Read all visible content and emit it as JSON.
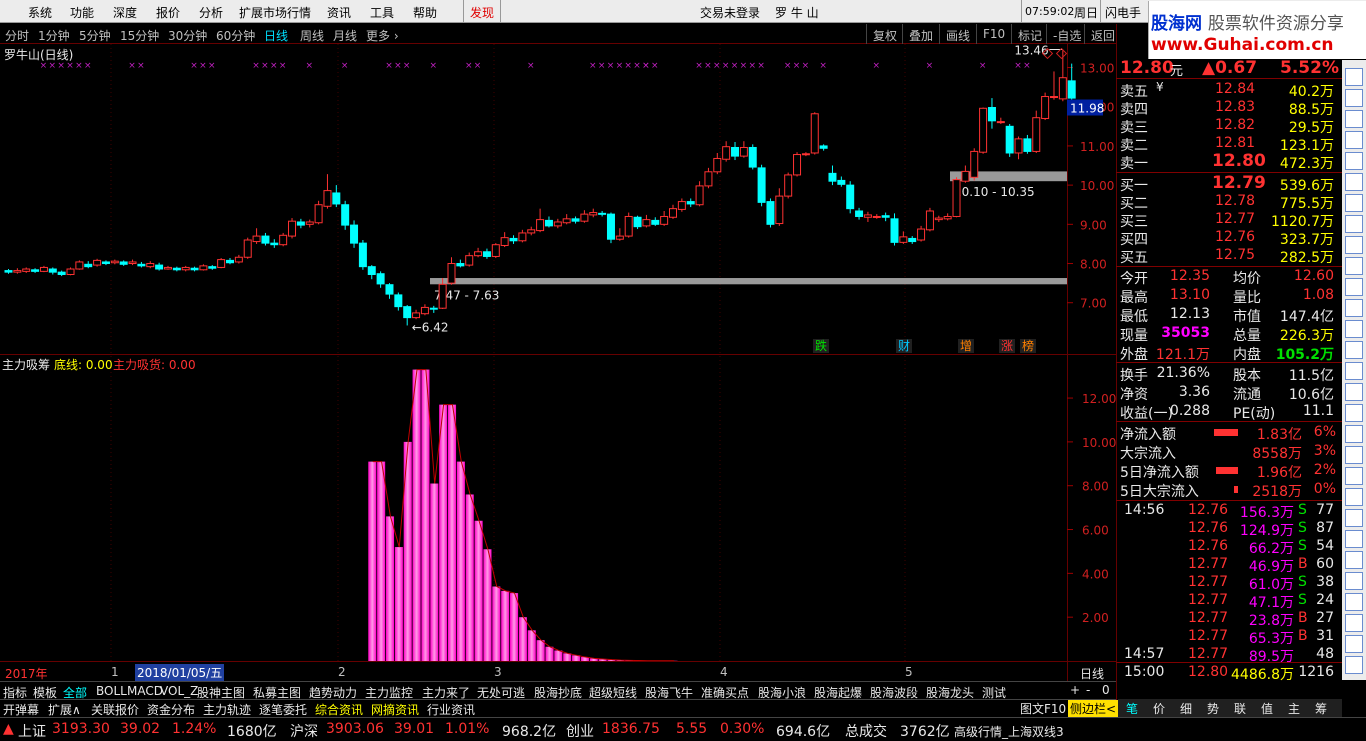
{
  "menubar": {
    "items": [
      "系统",
      "功能",
      "深度",
      "报价",
      "分析",
      "扩展市场行情",
      "资讯",
      "工具",
      "帮助"
    ],
    "discover": "发现",
    "login": "交易未登录",
    "stock": "罗 牛 山",
    "time": "07:59:02",
    "weekday": "周日",
    "flash": "闪电手"
  },
  "brand": {
    "name": "股海网",
    "slogan": "股票软件资源分享",
    "url": "www.Guhai.com.cn"
  },
  "periods": {
    "items": [
      "分时",
      "1分钟",
      "5分钟",
      "15分钟",
      "30分钟",
      "60分钟",
      "日线",
      "周线",
      "月线",
      "更多 ›"
    ],
    "selected": "日线"
  },
  "toolbar": {
    "buttons": [
      "复权",
      "叠加",
      "画线",
      "F10",
      "标记",
      "-自选",
      "返回"
    ]
  },
  "chart_title": "罗牛山(日线)",
  "chart_data": [
    {
      "type": "candlestick",
      "title": "罗牛山(日线)",
      "yticks": [
        "13.00",
        "12.00",
        "11.00",
        "10.00",
        "9.00",
        "8.00",
        "7.00"
      ],
      "ylim": [
        6.4,
        13.6
      ],
      "current_price_label": "11.98",
      "high_label": "13.46",
      "low_label": "6.42",
      "range_labels": [
        "7.47 - 7.63",
        "10.10 - 10.35"
      ],
      "event_marks": [
        "跌",
        "财",
        "增",
        "涨",
        "榜"
      ],
      "candles": [
        [
          7.82,
          7.78,
          7.86,
          7.74
        ],
        [
          7.78,
          7.82,
          7.88,
          7.74
        ],
        [
          7.8,
          7.86,
          7.9,
          7.76
        ],
        [
          7.84,
          7.8,
          7.88,
          7.76
        ],
        [
          7.8,
          7.9,
          7.94,
          7.78
        ],
        [
          7.86,
          7.78,
          7.9,
          7.72
        ],
        [
          7.78,
          7.72,
          7.82,
          7.68
        ],
        [
          7.72,
          7.86,
          7.9,
          7.7
        ],
        [
          7.86,
          8.04,
          8.08,
          7.84
        ],
        [
          7.98,
          7.92,
          8.06,
          7.88
        ],
        [
          7.96,
          8.08,
          8.12,
          7.92
        ],
        [
          8.04,
          8.0,
          8.08,
          7.96
        ],
        [
          8.02,
          8.06,
          8.1,
          7.98
        ],
        [
          8.04,
          7.98,
          8.08,
          7.94
        ],
        [
          8.0,
          8.04,
          8.1,
          7.96
        ],
        [
          7.98,
          7.94,
          8.04,
          7.9
        ],
        [
          7.92,
          8.0,
          8.06,
          7.88
        ],
        [
          7.96,
          7.86,
          8.02,
          7.82
        ],
        [
          7.86,
          7.9,
          7.94,
          7.84
        ],
        [
          7.88,
          7.84,
          7.92,
          7.8
        ],
        [
          7.84,
          7.9,
          7.94,
          7.8
        ],
        [
          7.88,
          7.84,
          7.92,
          7.8
        ],
        [
          7.84,
          7.94,
          7.98,
          7.82
        ],
        [
          7.92,
          7.88,
          7.96,
          7.84
        ],
        [
          7.9,
          8.1,
          8.14,
          7.88
        ],
        [
          8.08,
          8.02,
          8.14,
          7.98
        ],
        [
          8.04,
          8.16,
          8.22,
          8.0
        ],
        [
          8.16,
          8.6,
          8.66,
          8.12
        ],
        [
          8.56,
          8.7,
          8.9,
          8.5
        ],
        [
          8.7,
          8.52,
          8.78,
          8.46
        ],
        [
          8.52,
          8.48,
          8.62,
          8.4
        ],
        [
          8.48,
          8.72,
          8.78,
          8.44
        ],
        [
          8.7,
          9.08,
          9.16,
          8.64
        ],
        [
          9.06,
          8.98,
          9.14,
          8.9
        ],
        [
          9.0,
          9.06,
          9.12,
          8.92
        ],
        [
          9.04,
          9.5,
          9.6,
          9.0
        ],
        [
          9.46,
          9.86,
          10.28,
          9.4
        ],
        [
          9.8,
          9.52,
          10.0,
          9.44
        ],
        [
          9.5,
          8.98,
          9.6,
          8.86
        ],
        [
          8.98,
          8.52,
          9.1,
          8.4
        ],
        [
          8.52,
          7.92,
          8.6,
          7.84
        ],
        [
          7.92,
          7.72,
          7.96,
          7.6
        ],
        [
          7.74,
          7.48,
          7.8,
          7.38
        ],
        [
          7.46,
          7.22,
          7.5,
          7.1
        ],
        [
          7.2,
          6.9,
          7.26,
          6.8
        ],
        [
          6.9,
          6.62,
          6.94,
          6.42
        ],
        [
          6.62,
          6.74,
          6.82,
          6.58
        ],
        [
          6.72,
          6.88,
          6.96,
          6.68
        ],
        [
          6.86,
          6.84,
          6.92,
          6.74
        ],
        [
          6.86,
          7.47,
          7.63,
          6.84
        ],
        [
          7.5,
          8.0,
          8.16,
          7.46
        ],
        [
          8.0,
          7.94,
          8.1,
          7.9
        ],
        [
          7.96,
          8.2,
          8.28,
          7.92
        ],
        [
          8.2,
          8.3,
          8.4,
          8.16
        ],
        [
          8.3,
          8.18,
          8.38,
          8.12
        ],
        [
          8.18,
          8.48,
          8.52,
          8.14
        ],
        [
          8.46,
          8.66,
          8.8,
          8.42
        ],
        [
          8.64,
          8.58,
          8.72,
          8.5
        ],
        [
          8.58,
          8.78,
          8.86,
          8.54
        ],
        [
          8.78,
          8.86,
          8.94,
          8.72
        ],
        [
          8.84,
          9.12,
          9.4,
          8.8
        ],
        [
          9.1,
          8.96,
          9.2,
          8.92
        ],
        [
          8.96,
          9.06,
          9.14,
          8.9
        ],
        [
          9.04,
          9.14,
          9.26,
          9.0
        ],
        [
          9.14,
          9.08,
          9.2,
          9.02
        ],
        [
          9.08,
          9.26,
          9.36,
          9.04
        ],
        [
          9.24,
          9.3,
          9.4,
          9.18
        ],
        [
          9.28,
          9.26,
          9.34,
          9.2
        ],
        [
          9.26,
          8.62,
          9.3,
          8.52
        ],
        [
          8.62,
          8.7,
          8.9,
          8.58
        ],
        [
          8.7,
          9.2,
          9.3,
          8.66
        ],
        [
          9.18,
          8.94,
          9.22,
          8.88
        ],
        [
          8.96,
          9.12,
          9.24,
          8.92
        ],
        [
          9.1,
          9.0,
          9.18,
          8.96
        ],
        [
          9.0,
          9.2,
          9.34,
          8.96
        ],
        [
          9.18,
          9.4,
          9.5,
          9.14
        ],
        [
          9.38,
          9.58,
          9.66,
          9.32
        ],
        [
          9.58,
          9.52,
          9.66,
          9.44
        ],
        [
          9.5,
          9.98,
          10.1,
          9.46
        ],
        [
          9.98,
          10.34,
          10.44,
          9.92
        ],
        [
          10.34,
          10.68,
          10.82,
          10.28
        ],
        [
          10.66,
          10.98,
          11.12,
          10.6
        ],
        [
          10.96,
          10.74,
          11.1,
          10.64
        ],
        [
          10.74,
          10.96,
          11.12,
          10.7
        ],
        [
          10.96,
          10.46,
          11.04,
          10.4
        ],
        [
          10.44,
          9.56,
          10.52,
          9.46
        ],
        [
          9.58,
          9.0,
          9.66,
          8.92
        ],
        [
          9.02,
          9.72,
          9.92,
          8.96
        ],
        [
          9.72,
          10.26,
          10.32,
          9.66
        ],
        [
          10.26,
          10.78,
          10.84,
          10.22
        ],
        [
          10.78,
          10.8,
          10.84,
          10.74
        ],
        [
          10.82,
          11.82,
          11.86,
          10.78
        ],
        [
          11.0,
          10.94,
          11.04,
          10.88
        ],
        [
          10.3,
          10.1,
          10.5,
          10.0
        ],
        [
          10.12,
          10.02,
          10.22,
          9.96
        ],
        [
          10.0,
          9.4,
          10.1,
          9.28
        ],
        [
          9.34,
          9.2,
          9.42,
          9.12
        ],
        [
          9.18,
          9.24,
          9.32,
          9.06
        ],
        [
          9.2,
          9.2,
          9.26,
          9.14
        ],
        [
          9.22,
          9.18,
          9.3,
          9.08
        ],
        [
          9.14,
          8.54,
          9.28,
          8.46
        ],
        [
          8.54,
          8.68,
          8.82,
          8.5
        ],
        [
          8.64,
          8.56,
          8.7,
          8.5
        ],
        [
          8.6,
          8.88,
          8.96,
          8.56
        ],
        [
          8.86,
          9.34,
          9.42,
          8.82
        ],
        [
          9.12,
          9.16,
          9.22,
          9.06
        ],
        [
          9.14,
          9.2,
          9.28,
          9.1
        ],
        [
          9.2,
          10.14,
          10.2,
          9.18
        ],
        [
          10.1,
          10.35,
          10.5,
          10.06
        ],
        [
          10.2,
          10.86,
          10.94,
          10.12
        ],
        [
          10.84,
          11.96,
          11.98,
          10.8
        ],
        [
          11.98,
          11.64,
          12.22,
          11.44
        ],
        [
          11.6,
          11.62,
          11.72,
          11.56
        ],
        [
          11.5,
          10.82,
          11.56,
          10.72
        ],
        [
          10.82,
          11.18,
          11.24,
          10.66
        ],
        [
          11.18,
          10.86,
          11.28,
          10.8
        ],
        [
          10.86,
          11.72,
          11.9,
          10.82
        ],
        [
          11.7,
          12.26,
          12.36,
          11.66
        ],
        [
          12.26,
          12.26,
          12.9,
          12.18
        ],
        [
          12.2,
          12.74,
          13.46,
          12.14
        ],
        [
          12.66,
          12.22,
          13.1,
          12.13
        ]
      ]
    },
    {
      "type": "bar",
      "title": "主力吸筹",
      "legend": [
        "主力吸筹",
        "底线: 0.00",
        "主力吸货: 0.00"
      ],
      "yticks": [
        "12.00",
        "10.00",
        "8.00",
        "6.00",
        "4.00",
        "2.00"
      ],
      "ylim": [
        0,
        13.6
      ],
      "values": [
        0.0,
        0.0,
        0.0,
        0.0,
        0.0,
        0.0,
        0.0,
        0.0,
        0.0,
        0.0,
        0.0,
        0.0,
        0.0,
        0.0,
        0.0,
        0.0,
        0.0,
        0.0,
        0.0,
        0.0,
        0.0,
        0.0,
        0.0,
        0.0,
        0.0,
        0.0,
        0.0,
        0.0,
        0.0,
        0.0,
        0.0,
        0.0,
        0.0,
        0.0,
        0.0,
        0.0,
        0.0,
        0.0,
        0.0,
        0.0,
        0.0,
        9.1,
        9.1,
        6.6,
        5.2,
        10.0,
        13.3,
        13.3,
        8.1,
        11.7,
        11.7,
        9.1,
        7.6,
        6.4,
        5.1,
        3.4,
        3.2,
        3.1,
        2.0,
        1.4,
        0.95,
        0.65,
        0.48,
        0.35,
        0.26,
        0.18,
        0.12,
        0.09,
        0.06,
        0.04,
        0.03,
        0.02,
        0.01,
        0.01,
        0.01,
        0.01,
        0.0,
        0.0,
        0.0,
        0.0,
        0.0,
        0.0,
        0.0,
        0.0,
        0.0,
        0.0,
        0.0,
        0.0,
        0.0,
        0.0,
        0.0,
        0.0,
        0.0,
        0.0,
        0.0,
        0.0,
        0.0,
        0.0,
        0.0,
        0.0,
        0.0,
        0.0,
        0.0,
        0.0,
        0.0,
        0.0,
        0.0,
        0.0,
        0.0,
        0.0,
        0.0,
        0.0,
        0.0,
        0.0,
        0.0,
        0.0,
        0.0,
        0.0,
        0.0,
        0.0,
        0.0,
        0.0,
        0.0,
        0.0,
        0.0
      ]
    }
  ],
  "xaxis": {
    "labels": [
      "2017年",
      "1",
      "2018/01/05/五",
      "2",
      "3",
      "4",
      "5"
    ],
    "period": "日线"
  },
  "quote": {
    "price": "12.80",
    "unit": "元",
    "change": "▲0.67",
    "pct": "5.52%",
    "asks": [
      {
        "label": "卖五",
        "mark": "¥",
        "price": "12.84",
        "vol": "40.2万"
      },
      {
        "label": "卖四",
        "price": "12.83",
        "vol": "88.5万"
      },
      {
        "label": "卖三",
        "price": "12.82",
        "vol": "29.5万"
      },
      {
        "label": "卖二",
        "price": "12.81",
        "vol": "123.1万"
      },
      {
        "label": "卖一",
        "price": "12.80",
        "vol": "472.3万"
      }
    ],
    "bids": [
      {
        "label": "买一",
        "price": "12.79",
        "vol": "539.6万"
      },
      {
        "label": "买二",
        "price": "12.78",
        "vol": "775.5万"
      },
      {
        "label": "买三",
        "price": "12.77",
        "vol": "1120.7万"
      },
      {
        "label": "买四",
        "price": "12.76",
        "vol": "323.7万"
      },
      {
        "label": "买五",
        "price": "12.75",
        "vol": "282.5万"
      }
    ],
    "stats": [
      [
        "今开",
        "12.35",
        "均价",
        "12.60"
      ],
      [
        "最高",
        "13.10",
        "量比",
        "1.08"
      ],
      [
        "最低",
        "12.13",
        "市值",
        "147.4亿"
      ],
      [
        "现量",
        "35053",
        "总量",
        "226.3万"
      ],
      [
        "外盘",
        "121.1万",
        "内盘",
        "105.2万"
      ]
    ],
    "stats2": [
      [
        "换手",
        "21.36%",
        "股本",
        "11.5亿"
      ],
      [
        "净资",
        "3.36",
        "流通",
        "10.6亿"
      ],
      [
        "收益(一)",
        "0.288",
        "PE(动)",
        "11.1"
      ]
    ],
    "flows": [
      [
        "净流入额",
        "1.83亿",
        "6%"
      ],
      [
        "大宗流入",
        "8558万",
        "3%"
      ],
      [
        "5日净流入额",
        "1.96亿",
        "2%"
      ],
      [
        "5日大宗流入",
        "2518万",
        "0%"
      ]
    ],
    "ticks": [
      [
        "14:56",
        "12.76",
        "156.3万",
        "S",
        "77"
      ],
      [
        "",
        "12.76",
        "124.9万",
        "S",
        "87"
      ],
      [
        "",
        "12.76",
        "66.2万",
        "S",
        "54"
      ],
      [
        "",
        "12.77",
        "46.9万",
        "B",
        "60"
      ],
      [
        "",
        "12.77",
        "61.0万",
        "S",
        "38"
      ],
      [
        "",
        "12.77",
        "47.1万",
        "S",
        "24"
      ],
      [
        "",
        "12.77",
        "23.8万",
        "B",
        "27"
      ],
      [
        "",
        "12.77",
        "65.3万",
        "B",
        "31"
      ],
      [
        "14:57",
        "12.77",
        "89.5万",
        "",
        "48"
      ],
      [
        "15:00",
        "12.80",
        "4486.8万",
        "",
        "1216"
      ]
    ]
  },
  "indicator_tabs": [
    "指标",
    "模板",
    "全部",
    "BOLL",
    "MACD",
    "VOL_Z",
    "股神主图",
    "私募主图",
    "趋势动力",
    "主力监控",
    "主力来了",
    "无处可逃",
    "股海抄底",
    "超级短线",
    "股海飞牛",
    "准确买点",
    "股海小浪",
    "股海起爆",
    "股海波段",
    "股海龙头",
    "测试"
  ],
  "bottom_tabs": [
    "开弹幕",
    "扩展∧",
    "关联报价",
    "资金分布",
    "主力轨迹",
    "逐笔委托",
    "综合资讯",
    "网摘资讯",
    "行业资讯"
  ],
  "bottom_right": {
    "f10": "图文F10",
    "side": "侧边栏<"
  },
  "right_tabs": [
    "笔",
    "价",
    "细",
    "势",
    "联",
    "值",
    "主",
    "筹"
  ],
  "ticker": {
    "sh_label": "上证",
    "sh": "3193.30",
    "sh_chg": "39.02",
    "sh_pct": "1.24%",
    "sh_amt": "1680亿",
    "hs_label": "沪深",
    "hs": "3903.06",
    "hs_chg": "39.01",
    "hs_pct": "1.01%",
    "hs_amt": "968.2亿",
    "cy_label": "创业",
    "cy": "1836.75",
    "cy_chg": "5.55",
    "cy_pct": "0.30%",
    "cy_amt": "694.6亿",
    "total_label": "总成交",
    "total": "3762亿",
    "hint": "高级行情_上海双线3"
  },
  "colors": {
    "up": "#ff3232",
    "down": "#00ffff",
    "bg": "#000000",
    "grid": "#660000"
  }
}
